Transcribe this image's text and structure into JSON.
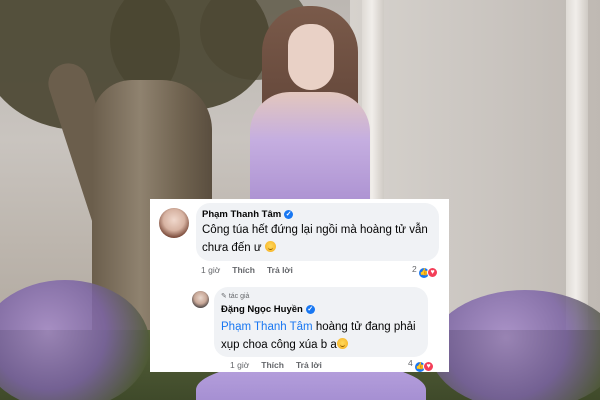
{
  "comments": [
    {
      "author": "Phạm Thanh Tâm",
      "text": "Công túa hết đứng lại ngồi mà hoàng tử vẫn chưa đến ư",
      "time": "1 giờ",
      "like_label": "Thích",
      "reply_label": "Trả lời",
      "reaction_count": "2"
    },
    {
      "author_tag": "tác giả",
      "author": "Đặng Ngọc Huyền",
      "mention": "Phạm Thanh Tâm",
      "text": " hoàng tử đang phải xụp choa công xúa b a",
      "time": "1 giờ",
      "like_label": "Thích",
      "reply_label": "Trả lời",
      "reaction_count": "4"
    }
  ],
  "icons": {
    "verified": "verified-badge-icon",
    "emoji": "grinning-emoji-icon",
    "like": "like-reaction-icon",
    "love": "love-reaction-icon",
    "author": "pencil-icon"
  },
  "colors": {
    "accent": "#1877f2",
    "love": "#f33e58",
    "bubble": "#f0f2f5",
    "meta_text": "#65676b"
  }
}
